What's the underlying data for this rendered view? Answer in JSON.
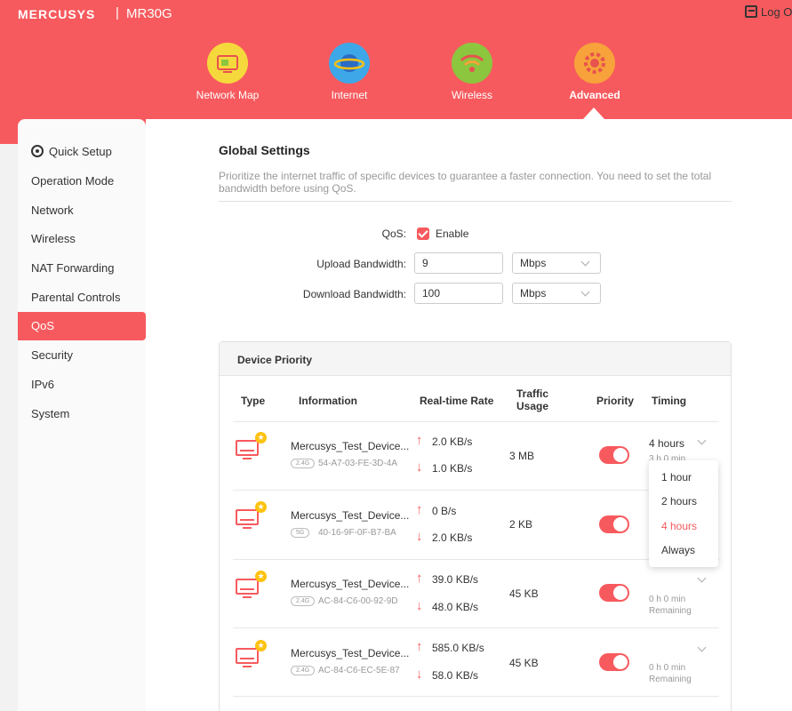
{
  "header": {
    "brand": "MERCUSYS",
    "separator": "|",
    "model": "MR30G",
    "logout": "Log O"
  },
  "nav": {
    "tabs": [
      {
        "label": "Network Map",
        "icon": "network-map-icon",
        "color": "#f5d93c"
      },
      {
        "label": "Internet",
        "icon": "internet-globe-icon",
        "color": "#3ea7e8"
      },
      {
        "label": "Wireless",
        "icon": "wireless-wifi-icon",
        "color": "#8cc63e"
      },
      {
        "label": "Advanced",
        "icon": "advanced-gear-icon",
        "color": "#f7a23a",
        "active": true
      }
    ]
  },
  "sidebar": {
    "items": [
      {
        "label": "Quick Setup",
        "icon": "gear-icon"
      },
      {
        "label": "Operation Mode"
      },
      {
        "label": "Network"
      },
      {
        "label": "Wireless"
      },
      {
        "label": "NAT Forwarding"
      },
      {
        "label": "Parental Controls"
      },
      {
        "label": "QoS",
        "active": true
      },
      {
        "label": "Security"
      },
      {
        "label": "IPv6"
      },
      {
        "label": "System"
      }
    ]
  },
  "global": {
    "title": "Global Settings",
    "description": "Prioritize the internet traffic of specific devices to guarantee a faster connection. You need to set the total bandwidth before using QoS.",
    "qos_label": "QoS:",
    "qos_enabled": true,
    "enable_label": "Enable",
    "upload_label": "Upload Bandwidth:",
    "upload_value": "9",
    "upload_unit": "Mbps",
    "download_label": "Download Bandwidth:",
    "download_value": "100",
    "download_unit": "Mbps"
  },
  "device_priority": {
    "title": "Device Priority",
    "columns": {
      "type": "Type",
      "information": "Information",
      "rate": "Real-time Rate",
      "usage_1": "Traffic",
      "usage_2": "Usage",
      "priority": "Priority",
      "timing": "Timing"
    },
    "devices": [
      {
        "name": "Mercusys_Test_Device...",
        "band": "2.4G",
        "mac": "54-A7-03-FE-3D-4A",
        "up": "2.0 KB/s",
        "down": "1.0 KB/s",
        "usage": "3 MB",
        "priority": true,
        "timing": "4 hours",
        "timing_sub": "3 h 0 min"
      },
      {
        "name": "Mercusys_Test_Device...",
        "band": "5G",
        "mac": "40-16-9F-0F-B7-BA",
        "up": "0 B/s",
        "down": "2.0 KB/s",
        "usage": "2 KB",
        "priority": true
      },
      {
        "name": "Mercusys_Test_Device...",
        "band": "2.4G",
        "mac": "AC-84-C6-00-92-9D",
        "up": "39.0 KB/s",
        "down": "48.0 KB/s",
        "usage": "45 KB",
        "priority": true,
        "timing_sub": "0 h 0 min",
        "timing_sub2": "Remaining"
      },
      {
        "name": "Mercusys_Test_Device...",
        "band": "2.4G",
        "mac": "AC-84-C6-EC-5E-87",
        "up": "585.0 KB/s",
        "down": "58.0 KB/s",
        "usage": "45 KB",
        "priority": true,
        "timing_sub": "0 h 0 min",
        "timing_sub2": "Remaining"
      }
    ],
    "timing_options": [
      "1 hour",
      "2 hours",
      "4 hours",
      "Always"
    ],
    "timing_selected": "4 hours"
  },
  "colors": {
    "accent": "#f75a5e",
    "star": "#ffc20e"
  }
}
